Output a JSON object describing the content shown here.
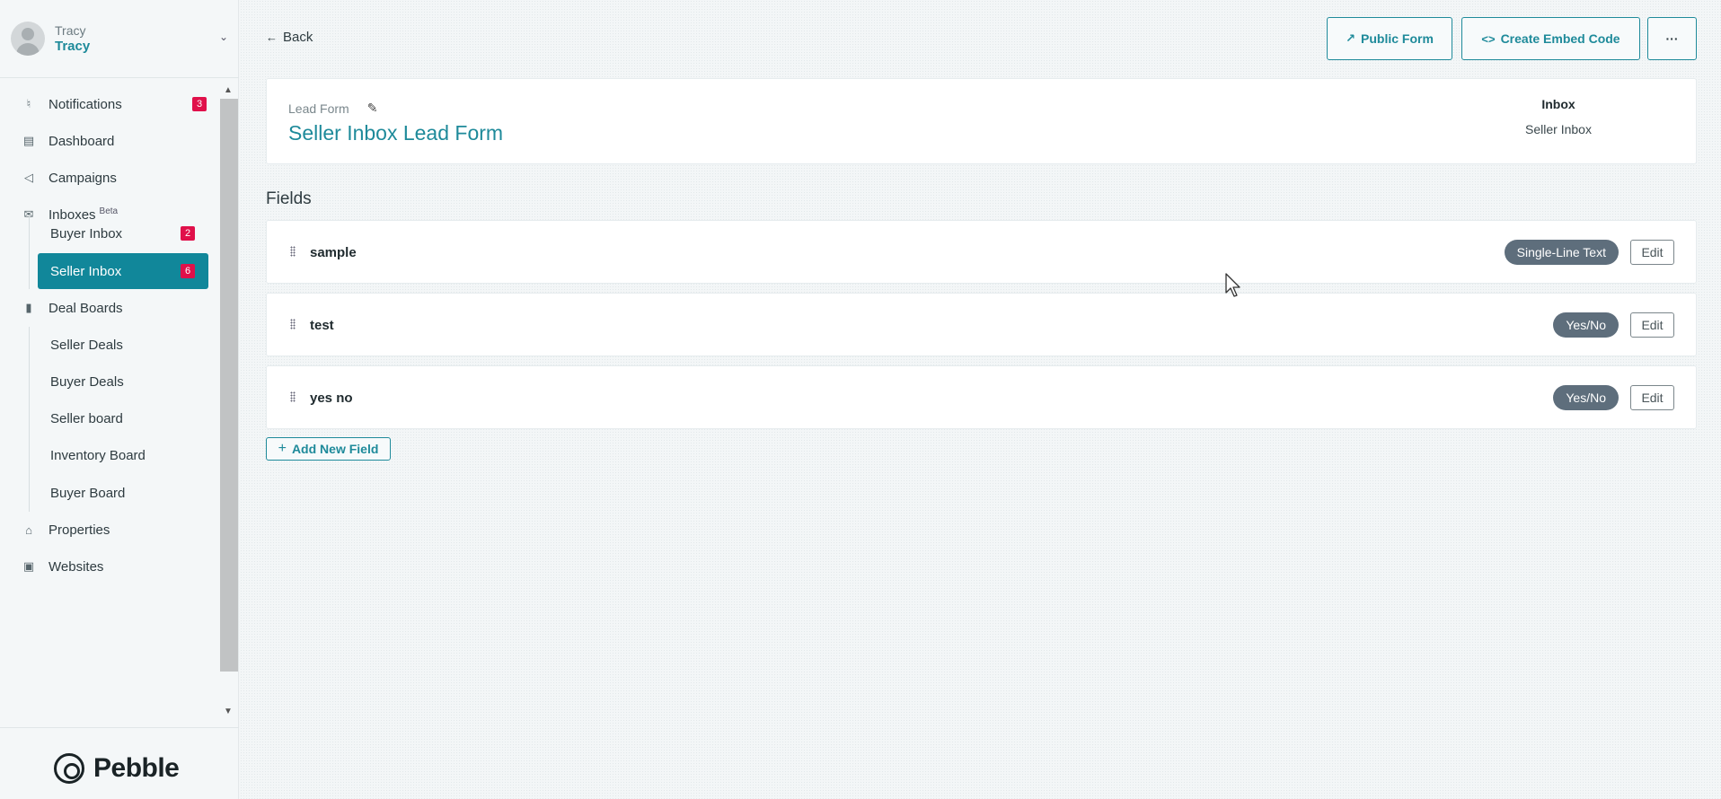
{
  "user": {
    "subtitle": "Tracy",
    "name": "Tracy"
  },
  "sidebar": {
    "items": [
      {
        "label": "Notifications",
        "icon": "bell-icon",
        "badge": "3"
      },
      {
        "label": "Dashboard",
        "icon": "dashboard-icon"
      },
      {
        "label": "Campaigns",
        "icon": "megaphone-icon"
      },
      {
        "label": "Inboxes",
        "icon": "inbox-icon",
        "tag": "Beta"
      },
      {
        "label": "Deal Boards",
        "icon": "board-icon"
      },
      {
        "label": "Properties",
        "icon": "home-icon"
      },
      {
        "label": "Websites",
        "icon": "browser-icon"
      }
    ],
    "inboxes": [
      {
        "label": "Buyer Inbox",
        "badge": "2"
      },
      {
        "label": "Seller Inbox",
        "badge": "6",
        "active": true
      }
    ],
    "boards": [
      {
        "label": "Seller Deals"
      },
      {
        "label": "Buyer Deals"
      },
      {
        "label": "Seller board"
      },
      {
        "label": "Inventory Board"
      },
      {
        "label": "Buyer Board"
      }
    ]
  },
  "brand": {
    "name": "Pebble"
  },
  "topbar": {
    "back_label": "Back",
    "public_form_label": "Public Form",
    "embed_label": "Create Embed Code",
    "more_label": "···"
  },
  "form": {
    "type_label": "Lead Form",
    "title": "Seller Inbox Lead Form",
    "inbox_label": "Inbox",
    "inbox_value": "Seller Inbox"
  },
  "fields_heading": "Fields",
  "fields": [
    {
      "name": "sample",
      "type": "Single-Line Text",
      "edit_label": "Edit"
    },
    {
      "name": "test",
      "type": "Yes/No",
      "edit_label": "Edit"
    },
    {
      "name": "yes no",
      "type": "Yes/No",
      "edit_label": "Edit"
    }
  ],
  "add_field_label": "Add New Field",
  "colors": {
    "accent": "#11879a",
    "badge": "#e0104a",
    "pill": "#5e6e7c"
  }
}
